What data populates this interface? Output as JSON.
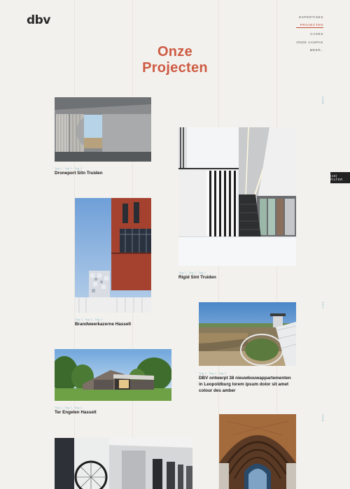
{
  "logo": "dbv",
  "nav": {
    "items": [
      {
        "label": "EXPERTISES",
        "active": false
      },
      {
        "label": "PROJECTEN",
        "active": true
      },
      {
        "label": "CASES",
        "active": false
      },
      {
        "label": "ONZE AANPAK",
        "active": false
      },
      {
        "label": "MEER..",
        "active": false
      }
    ]
  },
  "page_title": {
    "line1": "Onze",
    "line2": "Projecten"
  },
  "filter_label": "(10) FILTER",
  "side_labels": [
    "2016",
    "2017",
    "2018"
  ],
  "projects": [
    {
      "tags": "Tag 1, Tag 1, Tag 2",
      "title_lines": [
        "Droneport Sitn Truiden"
      ]
    },
    {
      "tags": "Tag 1, Tag 1, Tag 2",
      "title_lines": [
        "Rigid Sint Truiden"
      ]
    },
    {
      "tags": "Tag 1, Tag 1, Tag 2",
      "title_lines": [
        "Brandweerkazerne Hasselt"
      ]
    },
    {
      "tags": "Tag 1, Tag 1, Tag 2",
      "title_lines": [
        "DBV ontwerpt 38 nieuwbouwappartementen",
        "in Leopoldburg lorem ipsum dolor sit amet",
        "colour des amber"
      ]
    },
    {
      "tags": "Tag 1, Tag 1, Tag 2",
      "title_lines": [
        "Ter Engelen Hasselt"
      ]
    },
    {
      "tags": "",
      "title_lines": []
    },
    {
      "tags": "",
      "title_lines": []
    }
  ]
}
